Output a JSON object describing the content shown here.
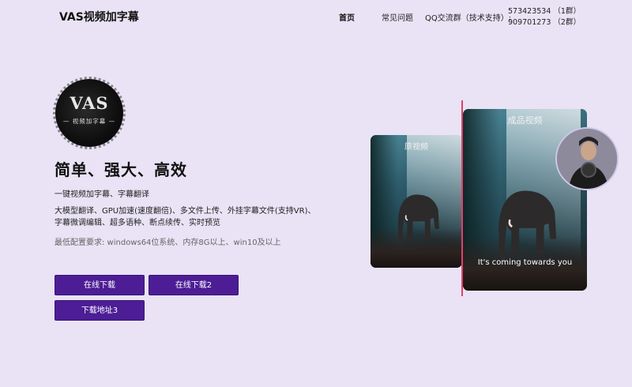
{
  "header": {
    "brand": "VAS视频加字幕",
    "nav": {
      "home": "首页",
      "faq": "常见问题",
      "qq_label": "QQ交流群（技术支持）:",
      "qq_groups": [
        "573423534 （1群）",
        "909701273 （2群）"
      ]
    }
  },
  "hero": {
    "logo_main": "VAS",
    "logo_sub": "— 视频加字幕 —",
    "headline": "简单、强大、高效",
    "tagline": "一键视频加字幕、字幕翻译",
    "features": "大模型翻译、GPU加速(速度翻倍)、多文件上传、外挂字幕文件(支持VR)、字幕微调编辑、超多语种、断点续传、实时预览",
    "requirements": "最低配置要求: windows64位系统、内存8G以上、win10及以上",
    "buttons": {
      "download1": "在线下载",
      "download2": "在线下载2",
      "download3": "下载地址3"
    }
  },
  "preview": {
    "original_label": "原视频",
    "final_label": "成品视频",
    "caption": "It's coming towards you"
  },
  "colors": {
    "background": "#e9e3f5",
    "button": "#4c1d95",
    "divider": "#e0406a"
  }
}
